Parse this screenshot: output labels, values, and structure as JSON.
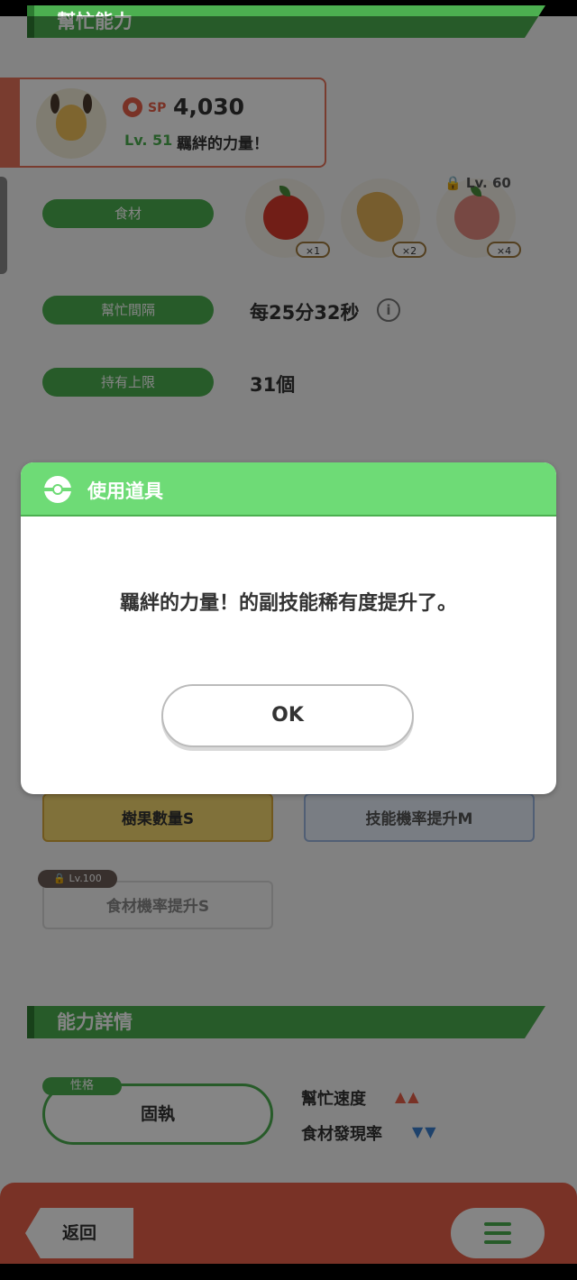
{
  "section_top": {
    "title": "幫忙能力"
  },
  "profile": {
    "sp_label": "SP",
    "sp_value": "4,030",
    "level": "Lv. 51",
    "skill_name": "羈絆的力量！"
  },
  "help_ability": {
    "ingredient_label": "食材",
    "interval_label": "幫忙間隔",
    "interval_value": "每25分32秒",
    "limit_label": "持有上限",
    "limit_value": "31個",
    "ingredients": [
      {
        "name": "apple",
        "count": "×1"
      },
      {
        "name": "ginger",
        "count": "×2"
      },
      {
        "name": "apple",
        "count": "×4",
        "lock_level": "Lv. 60"
      }
    ]
  },
  "subskills": {
    "tile1": "樹果數量S",
    "tile2": "技能機率提升M",
    "tile3": "食材機率提升S",
    "tile3_lock": "Lv.100"
  },
  "details": {
    "title": "能力詳情",
    "nature_label": "性格",
    "nature_value": "固執",
    "stat1": "幫忙速度",
    "stat1_arrows": "▲▲",
    "stat2": "食材發現率",
    "stat2_arrows": "▼▼"
  },
  "nav": {
    "back": "返回"
  },
  "dialog": {
    "title": "使用道具",
    "message": "羈絆的力量！的副技能稀有度提升了。",
    "ok": "OK"
  },
  "colors": {
    "green": "#4caf50",
    "accent_red": "#e8604a",
    "dialog_header": "#6edb76"
  }
}
